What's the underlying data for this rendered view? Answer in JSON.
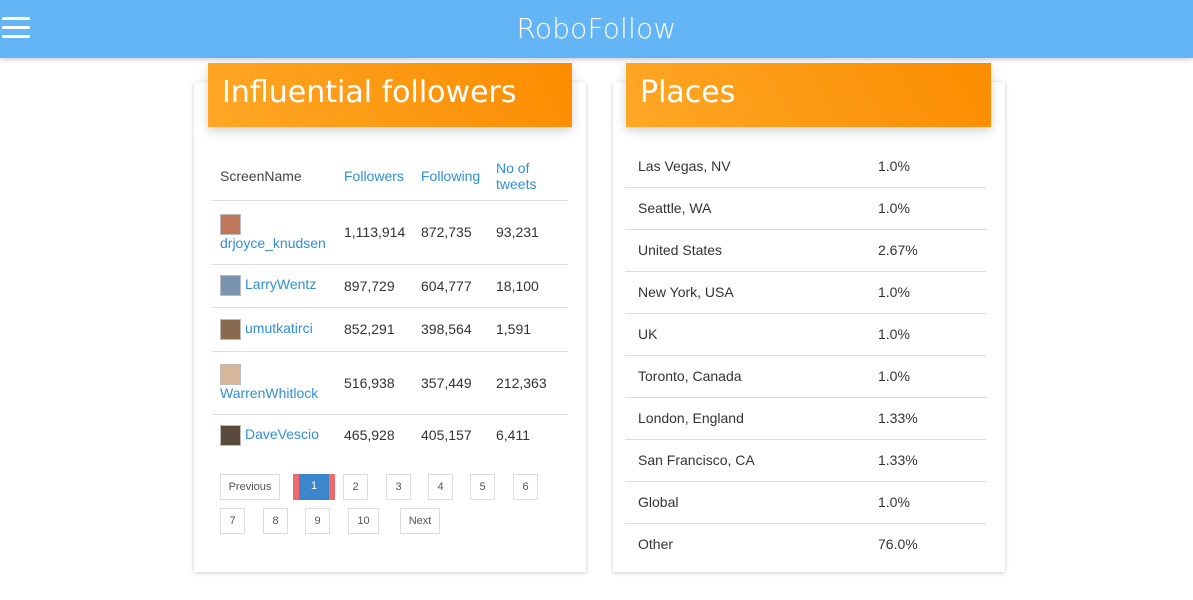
{
  "header": {
    "title": "RoboFollow",
    "menu_icon": "hamburger-menu-icon",
    "bg_color": "#64b5f6"
  },
  "followers": {
    "title": "Influential followers",
    "columns": {
      "screen_name": "ScreenName",
      "followers": "Followers",
      "following": "Following",
      "tweets": "No of tweets"
    },
    "rows": [
      {
        "name": "drjoyce_knudsen",
        "followers": "1,113,914",
        "following": "872,735",
        "tweets": "93,231"
      },
      {
        "name": "LarryWentz",
        "followers": "897,729",
        "following": "604,777",
        "tweets": "18,100"
      },
      {
        "name": "umutkatirci",
        "followers": "852,291",
        "following": "398,564",
        "tweets": "1,591"
      },
      {
        "name": "WarrenWhitlock",
        "followers": "516,938",
        "following": "357,449",
        "tweets": "212,363"
      },
      {
        "name": "DaveVescio",
        "followers": "465,928",
        "following": "405,157",
        "tweets": "6,411"
      }
    ],
    "pagination": {
      "previous": "Previous",
      "next": "Next",
      "pages": [
        "1",
        "2",
        "3",
        "4",
        "5",
        "6",
        "7",
        "8",
        "9",
        "10"
      ],
      "active_page": "1"
    }
  },
  "places": {
    "title": "Places",
    "rows": [
      {
        "name": "Las Vegas, NV",
        "pct": "1.0%"
      },
      {
        "name": "Seattle, WA",
        "pct": "1.0%"
      },
      {
        "name": "United States",
        "pct": "2.67%"
      },
      {
        "name": "New York, USA",
        "pct": "1.0%"
      },
      {
        "name": "UK",
        "pct": "1.0%"
      },
      {
        "name": "Toronto, Canada",
        "pct": "1.0%"
      },
      {
        "name": "London, England",
        "pct": "1.33%"
      },
      {
        "name": "San Francisco, CA",
        "pct": "1.33%"
      },
      {
        "name": "Global",
        "pct": "1.0%"
      },
      {
        "name": "Other",
        "pct": "76.0%"
      }
    ]
  },
  "colors": {
    "accent_orange": "#fb8c00",
    "link_blue": "#2f8fd8",
    "active_page": "#3b86cc"
  }
}
